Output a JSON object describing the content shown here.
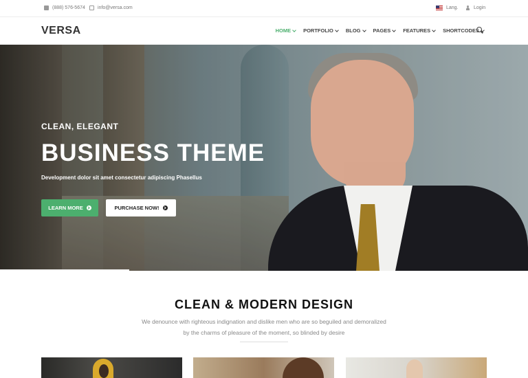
{
  "topbar": {
    "phone": "(888) 576-5674",
    "email": "info@versa.com",
    "lang_label": "Lang.",
    "login_label": "Login"
  },
  "header": {
    "logo": "VERSA",
    "nav": [
      {
        "label": "HOME",
        "active": true
      },
      {
        "label": "PORTFOLIO",
        "active": false
      },
      {
        "label": "BLOG",
        "active": false
      },
      {
        "label": "PAGES",
        "active": false
      },
      {
        "label": "FEATURES",
        "active": false
      },
      {
        "label": "SHORTCODES",
        "active": false
      }
    ],
    "accent_color": "#4caf6e"
  },
  "hero": {
    "eyebrow": "CLEAN, ELEGANT",
    "title": "BUSINESS THEME",
    "subtitle": "Development dolor sit amet consectetur adipiscing Phasellus",
    "primary_button": "LEARN MORE",
    "secondary_button": "PURCHASE NOW!"
  },
  "section": {
    "title": "CLEAN & MODERN DESIGN",
    "text": "We denounce with righteous indignation and dislike men who are so beguiled and demoralized by the charms of pleasure of the moment, so blinded by desire"
  }
}
